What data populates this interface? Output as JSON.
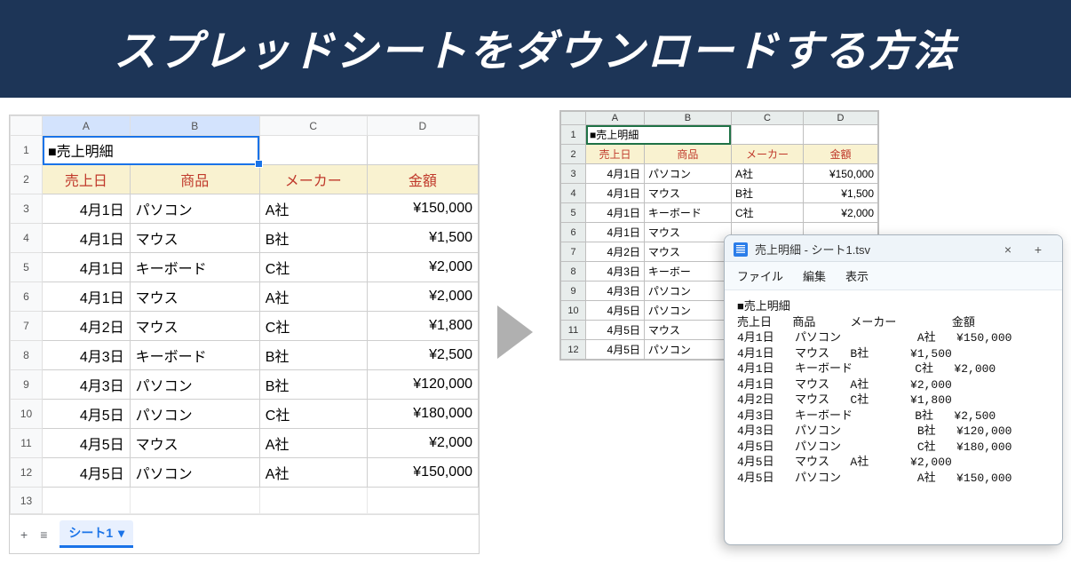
{
  "banner": {
    "title": "スプレッドシートをダウンロードする方法"
  },
  "sheets_left": {
    "columns": [
      "A",
      "B",
      "C",
      "D"
    ],
    "title_cell": "■売上明細",
    "headers": {
      "date": "売上日",
      "product": "商品",
      "maker": "メーカー",
      "amount": "金額"
    },
    "rows": [
      {
        "date": "4月1日",
        "product": "パソコン",
        "maker": "A社",
        "amount": "¥150,000"
      },
      {
        "date": "4月1日",
        "product": "マウス",
        "maker": "B社",
        "amount": "¥1,500"
      },
      {
        "date": "4月1日",
        "product": "キーボード",
        "maker": "C社",
        "amount": "¥2,000"
      },
      {
        "date": "4月1日",
        "product": "マウス",
        "maker": "A社",
        "amount": "¥2,000"
      },
      {
        "date": "4月2日",
        "product": "マウス",
        "maker": "C社",
        "amount": "¥1,800"
      },
      {
        "date": "4月3日",
        "product": "キーボード",
        "maker": "B社",
        "amount": "¥2,500"
      },
      {
        "date": "4月3日",
        "product": "パソコン",
        "maker": "B社",
        "amount": "¥120,000"
      },
      {
        "date": "4月5日",
        "product": "パソコン",
        "maker": "C社",
        "amount": "¥180,000"
      },
      {
        "date": "4月5日",
        "product": "マウス",
        "maker": "A社",
        "amount": "¥2,000"
      },
      {
        "date": "4月5日",
        "product": "パソコン",
        "maker": "A社",
        "amount": "¥150,000"
      }
    ],
    "extra_row_number": "13",
    "tabs": {
      "add": "+",
      "all": "≡",
      "name": "シート1",
      "caret": "▾"
    }
  },
  "sheets_right": {
    "columns": [
      "A",
      "B",
      "C",
      "D"
    ],
    "title_cell": "■売上明細",
    "headers": {
      "date": "売上日",
      "product": "商品",
      "maker": "メーカー",
      "amount": "金額"
    },
    "rows": [
      {
        "date": "4月1日",
        "product": "パソコン",
        "maker": "A社",
        "amount": "¥150,000"
      },
      {
        "date": "4月1日",
        "product": "マウス",
        "maker": "B社",
        "amount": "¥1,500"
      },
      {
        "date": "4月1日",
        "product": "キーボード",
        "maker": "C社",
        "amount": "¥2,000"
      },
      {
        "date": "4月1日",
        "product": "マウス",
        "maker": "",
        "amount": ""
      },
      {
        "date": "4月2日",
        "product": "マウス",
        "maker": "",
        "amount": ""
      },
      {
        "date": "4月3日",
        "product": "キーボー",
        "maker": "",
        "amount": ""
      },
      {
        "date": "4月3日",
        "product": "パソコン",
        "maker": "",
        "amount": ""
      },
      {
        "date": "4月5日",
        "product": "パソコン",
        "maker": "",
        "amount": ""
      },
      {
        "date": "4月5日",
        "product": "マウス",
        "maker": "",
        "amount": ""
      },
      {
        "date": "4月5日",
        "product": "パソコン",
        "maker": "",
        "amount": ""
      }
    ]
  },
  "notepad": {
    "title": "売上明細 - シート1.tsv",
    "close": "×",
    "newtab": "+",
    "menu": {
      "file": "ファイル",
      "edit": "編集",
      "view": "表示"
    },
    "lines": [
      "■売上明細",
      "売上日   商品     メーカー        金額",
      "4月1日   パソコン           A社   ¥150,000",
      "4月1日   マウス   B社      ¥1,500",
      "4月1日   キーボード         C社   ¥2,000",
      "4月1日   マウス   A社      ¥2,000",
      "4月2日   マウス   C社      ¥1,800",
      "4月3日   キーボード         B社   ¥2,500",
      "4月3日   パソコン           B社   ¥120,000",
      "4月5日   パソコン           C社   ¥180,000",
      "4月5日   マウス   A社      ¥2,000",
      "4月5日   パソコン           A社   ¥150,000"
    ]
  }
}
